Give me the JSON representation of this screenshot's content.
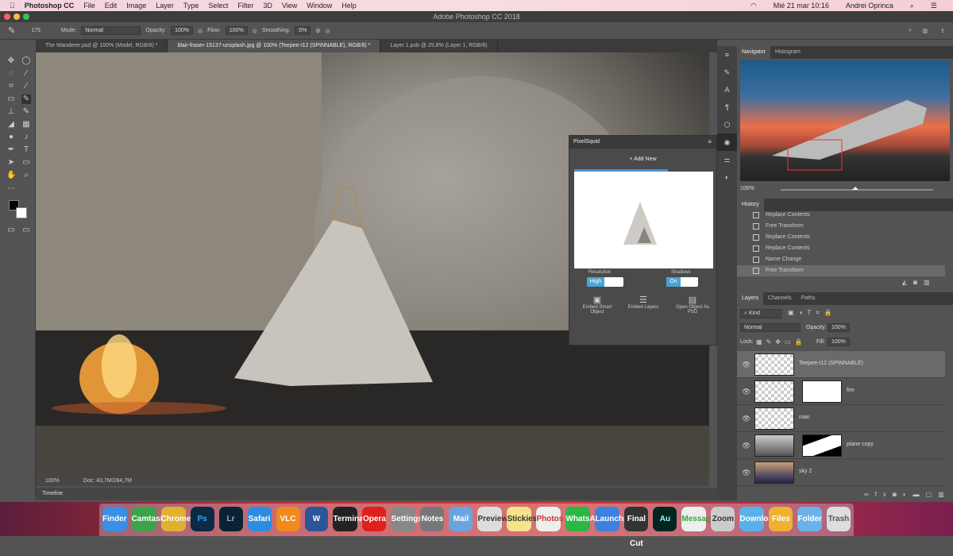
{
  "menubar": {
    "app": "Photoshop CC",
    "items": [
      "File",
      "Edit",
      "Image",
      "Layer",
      "Type",
      "Select",
      "Filter",
      "3D",
      "View",
      "Window",
      "Help"
    ],
    "clock": "Mié 21 mar  10:16",
    "user": "Andrei Oprinca"
  },
  "window": {
    "title": "Adobe Photoshop CC 2018"
  },
  "options": {
    "brush_size": "175",
    "mode_label": "Mode:",
    "mode": "Normal",
    "opacity_label": "Opacity:",
    "opacity": "100%",
    "flow_label": "Flow:",
    "flow": "100%",
    "smoothing_label": "Smoothing:",
    "smoothing": "0%"
  },
  "tabs": [
    "The Wanderer.psd @ 100% (Model, RGB/8) *",
    "blair-fraser-15137-unsplash.jpg @ 100% (Teepee-I12 (SPINNABLE), RGB/8) *",
    "Layer 1.psb @ 25,8% (Layer 1, RGB/8)"
  ],
  "status": {
    "zoom": "100%",
    "doc": "Doc: 43,7M/284,7M"
  },
  "timeline": "Timeline",
  "navigator": {
    "tabs": [
      "Navigator",
      "Histogram"
    ],
    "zoom": "100%"
  },
  "history": {
    "title": "History",
    "items": [
      "Replace Contents",
      "Free Transform",
      "Replace Contents",
      "Replace Contents",
      "Name Change",
      "Free Transform"
    ]
  },
  "layers": {
    "tabs": [
      "Layers",
      "Channels",
      "Paths"
    ],
    "filter": "Kind",
    "blend": "Normal",
    "opacity_label": "Opacity:",
    "opacity": "100%",
    "lock_label": "Lock:",
    "fill_label": "Fill:",
    "fill": "100%",
    "items": [
      {
        "name": "Teepee-I12 (SPINNABLE)",
        "selected": true
      },
      {
        "name": "fire"
      },
      {
        "name": "man"
      },
      {
        "name": "plane copy"
      },
      {
        "name": "sky 2"
      }
    ]
  },
  "pixelsquid": {
    "title": "PixelSquid",
    "add_new": "+ Add New",
    "resolution_label": "Resolution",
    "resolution": "High",
    "shadows_label": "Shadows",
    "shadows": "On",
    "actions": [
      "Embed Smart Object",
      "Embed Layers",
      "Open Object As PSD"
    ]
  },
  "dock": {
    "apps": [
      "Finder",
      "Camtasia",
      "Chrome",
      "Ps",
      "Lr",
      "Safari",
      "VLC",
      "W",
      "Terminal",
      "Opera",
      "Settings",
      "Notes",
      "Mail",
      "Preview",
      "Stickies",
      "Photos",
      "WhatsApp",
      "Launchpad",
      "Final Cut",
      "Au",
      "Messages",
      "Zoom",
      "Downloads",
      "Files",
      "Folder",
      "Trash"
    ]
  }
}
